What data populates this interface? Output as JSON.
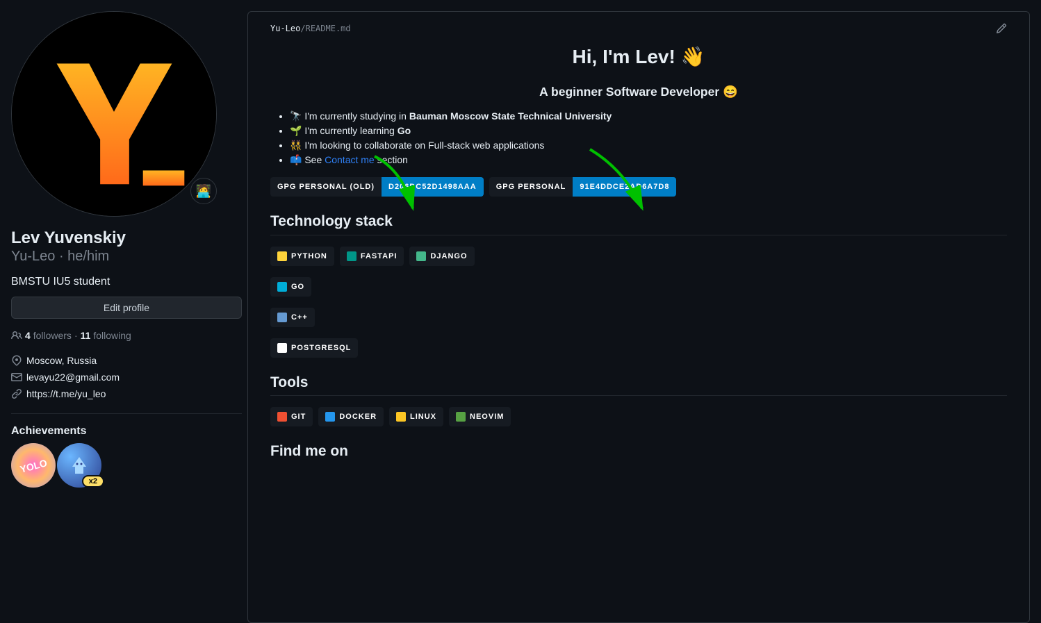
{
  "profile": {
    "name": "Lev Yuvenskiy",
    "username": "Yu-Leo",
    "pronouns": "he/him",
    "bio": "BMSTU IU5 student",
    "edit_label": "Edit profile",
    "followers_count": "4",
    "followers_label": "followers",
    "following_count": "11",
    "following_label": "following",
    "location": "Moscow, Russia",
    "email": "levayu22@gmail.com",
    "website": "https://t.me/yu_leo",
    "status_emoji": "🧑‍💻",
    "achievements_title": "Achievements",
    "achievements": [
      {
        "name": "YOLO",
        "count": ""
      },
      {
        "name": "Pull Shark",
        "count": "x2"
      }
    ]
  },
  "readme": {
    "owner": "Yu-Leo",
    "file": "README",
    "ext": ".md",
    "title": "Hi, I'm Lev! 👋",
    "subtitle": "A beginner Software Developer 😄",
    "bullets": [
      {
        "emoji": "🔭",
        "prefix": "I'm currently studying in ",
        "bold": "Bauman Moscow State Technical University",
        "suffix": ""
      },
      {
        "emoji": "🌱",
        "prefix": "I'm currently learning ",
        "bold": "Go",
        "suffix": ""
      },
      {
        "emoji": "👯",
        "prefix": "I'm looking to collaborate on Full-stack web applications",
        "bold": "",
        "suffix": ""
      },
      {
        "emoji": "📫",
        "prefix": "See ",
        "link": "Contact me",
        "suffix": " section"
      }
    ],
    "gpg_badges": [
      {
        "label": "GPG PERSONAL (OLD)",
        "value": "D206DC52D1498AAA"
      },
      {
        "label": "GPG PERSONAL",
        "value": "91E4DDCE2AD6A7D8"
      }
    ],
    "h2_tech": "Technology stack",
    "tech_rows": [
      [
        {
          "icon_color": "#ffd43b",
          "label": "PYTHON"
        },
        {
          "icon_color": "#009688",
          "label": "FASTAPI"
        },
        {
          "icon_color": "#44b78b",
          "label": "DJANGO"
        }
      ],
      [
        {
          "icon_color": "#00add8",
          "label": "GO"
        }
      ],
      [
        {
          "icon_color": "#659ad2",
          "label": "C++"
        }
      ],
      [
        {
          "icon_color": "#ffffff",
          "label": "POSTGRESQL"
        }
      ]
    ],
    "h2_tools": "Tools",
    "tools_row": [
      {
        "icon_color": "#f05032",
        "label": "GIT"
      },
      {
        "icon_color": "#2496ed",
        "label": "DOCKER"
      },
      {
        "icon_color": "#fcc624",
        "label": "LINUX"
      },
      {
        "icon_color": "#57a143",
        "label": "NEOVIM"
      }
    ],
    "h2_find": "Find me on"
  }
}
